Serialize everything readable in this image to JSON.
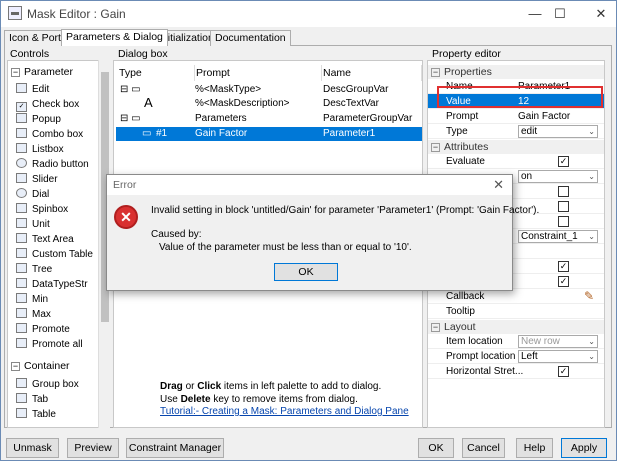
{
  "window": {
    "title": "Mask Editor : Gain",
    "min_label": "—",
    "max_label": "☐",
    "close_label": "✕"
  },
  "tabs": [
    "Icon & Ports",
    "Parameters & Dialog",
    "Initialization",
    "Documentation"
  ],
  "controls": {
    "header": "Controls",
    "groups": [
      {
        "label": "Parameter",
        "items": [
          "Edit",
          "Check box",
          "Popup",
          "Combo box",
          "Listbox",
          "Radio button",
          "Slider",
          "Dial",
          "Spinbox",
          "Unit",
          "Text Area",
          "Custom Table",
          "Tree",
          "DataTypeStr",
          "Min",
          "Max",
          "Promote",
          "Promote all"
        ]
      },
      {
        "label": "Container",
        "items": [
          "Group box",
          "Tab",
          "Table"
        ]
      }
    ]
  },
  "dialog_box": {
    "header": "Dialog box",
    "columns": [
      "Type",
      "Prompt",
      "Name"
    ],
    "rows": [
      {
        "type": "",
        "prompt": "%<MaskType>",
        "name": "DescGroupVar"
      },
      {
        "type": "A",
        "prompt": "%<MaskDescription>",
        "name": "DescTextVar"
      },
      {
        "type": "",
        "prompt": "Parameters",
        "name": "ParameterGroupVar"
      },
      {
        "type": "#1",
        "prompt": "Gain Factor",
        "name": "Parameter1"
      }
    ],
    "hint_line1_bold_a": "Drag",
    "hint_line1_or": " or ",
    "hint_line1_bold_b": "Click",
    "hint_line1_rest": " items in left palette to add to dialog.",
    "hint_line2_use": "Use ",
    "hint_line2_bold": "Delete",
    "hint_line2_rest": " key to remove items from dialog.",
    "tutorial_link": "Tutorial:- Creating a Mask: Parameters and Dialog Pane"
  },
  "property_editor": {
    "header": "Property editor",
    "sections": {
      "properties": "Properties",
      "attributes": "Attributes",
      "layout": "Layout"
    },
    "properties": [
      {
        "key": "Name",
        "value": "Parameter1"
      },
      {
        "key": "Value",
        "value": "12"
      },
      {
        "key": "Prompt",
        "value": "Gain Factor"
      },
      {
        "key": "Type",
        "value": "edit"
      }
    ],
    "attributes": {
      "evaluate_label": "Evaluate",
      "tunable_value": "on",
      "constraint_value": "Constraint_1",
      "callback_label": "Callback",
      "tooltip_label": "Tooltip"
    },
    "layout": [
      {
        "key": "Item location",
        "value": "New row"
      },
      {
        "key": "Prompt location",
        "value": "Left"
      },
      {
        "key": "Horizontal Stret...",
        "value": ""
      }
    ]
  },
  "buttons": {
    "unmask": "Unmask",
    "preview": "Preview",
    "constraint_manager": "Constraint Manager",
    "ok": "OK",
    "cancel": "Cancel",
    "help": "Help",
    "apply": "Apply"
  },
  "error_dialog": {
    "title": "Error",
    "message": "Invalid setting in block 'untitled/Gain' for parameter 'Parameter1' (Prompt: 'Gain Factor').",
    "caused_by": "Caused by:",
    "detail": "Value of the parameter must be less than or equal to '10'.",
    "ok": "OK"
  },
  "colors": {
    "selection": "#0078d7",
    "highlight_box": "#e03030",
    "error_icon": "#d93030"
  }
}
